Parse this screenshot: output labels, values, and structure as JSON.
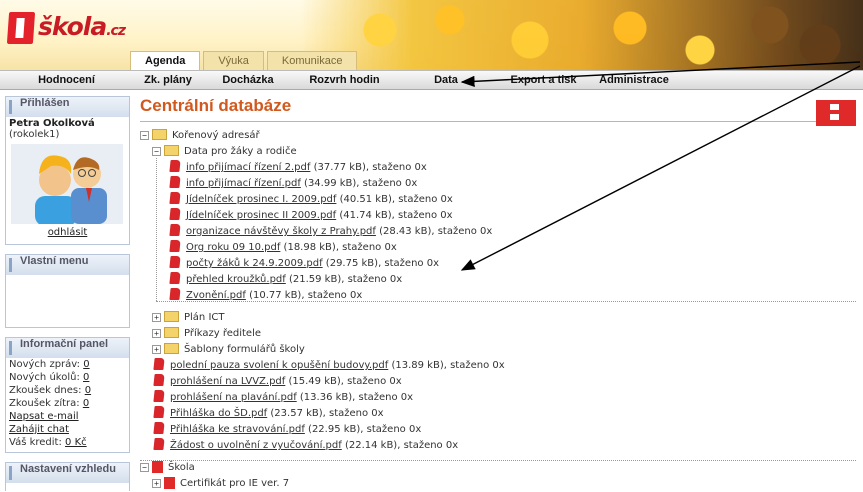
{
  "logo": {
    "text": "škola",
    "suffix": ".cz",
    "prefix": "i"
  },
  "tabs": [
    {
      "label": "Agenda"
    },
    {
      "label": "Výuka"
    },
    {
      "label": "Komunikace"
    }
  ],
  "menu": [
    {
      "label": "Hodnocení"
    },
    {
      "label": "Zk. plány"
    },
    {
      "label": "Docházka"
    },
    {
      "label": "Rozvrh hodin"
    },
    {
      "label": "Data"
    },
    {
      "label": "Export a tisk"
    },
    {
      "label": "Administrace"
    }
  ],
  "sidebar": {
    "login_title": "Přihlášen",
    "user_name": "Petra Okolková",
    "user_login": "(rokolek1)",
    "logout": "odhlásit",
    "own_menu": "Vlastní menu",
    "info_title": "Informační panel",
    "info": {
      "new_messages_label": "Nových zpráv:",
      "new_messages": "0",
      "new_tasks_label": "Nových úkolů:",
      "new_tasks": "0",
      "tests_today_label": "Zkoušek dnes:",
      "tests_today": "0",
      "tests_tomorrow_label": "Zkoušek zítra:",
      "tests_tomorrow": "0",
      "write_email": "Napsat e-mail",
      "start_chat": "Zahájit chat",
      "credit_label": "Váš kredit:",
      "credit": "0 Kč"
    },
    "appearance": "Nastavení vzhledu"
  },
  "main": {
    "title": "Centrální databáze",
    "root": "Kořenový adresář",
    "folder1": "Data pro žáky a rodiče",
    "files1": [
      {
        "name": "info přijímací řízení 2.pdf",
        "meta": " (37.77 kB), staženo 0x"
      },
      {
        "name": "info přijímací řízení.pdf",
        "meta": " (34.99 kB), staženo 0x"
      },
      {
        "name": "Jídelníček prosinec  I. 2009.pdf",
        "meta": " (40.51 kB), staženo 0x"
      },
      {
        "name": "Jídelníček prosinec II 2009.pdf",
        "meta": " (41.74 kB), staženo 0x"
      },
      {
        "name": "organizace návštěvy školy z Prahy.pdf",
        "meta": " (28.43 kB), staženo 0x"
      },
      {
        "name": "Org  roku  09  10.pdf",
        "meta": " (18.98 kB), staženo 0x"
      },
      {
        "name": "počty žáků k 24.9.2009.pdf",
        "meta": " (29.75 kB), staženo 0x"
      },
      {
        "name": "přehled kroužků.pdf",
        "meta": " (21.59 kB), staženo 0x"
      },
      {
        "name": "Zvonění.pdf",
        "meta": " (10.77 kB), staženo 0x"
      }
    ],
    "folders": [
      {
        "label": "Plán ICT"
      },
      {
        "label": "Příkazy ředitele"
      },
      {
        "label": "Šablony formulářů školy"
      }
    ],
    "files2": [
      {
        "name": "polední pauza svolení k opušění budovy.pdf",
        "meta": " (13.89 kB), staženo 0x"
      },
      {
        "name": "prohlášení na LVVZ.pdf",
        "meta": " (15.49 kB), staženo 0x"
      },
      {
        "name": "prohlášení na plavání.pdf",
        "meta": " (13.36 kB), staženo 0x"
      },
      {
        "name": "Přihláška do ŠD.pdf",
        "meta": " (23.57 kB), staženo 0x"
      },
      {
        "name": "Přihláška ke stravování.pdf",
        "meta": " (22.95 kB), staženo 0x"
      },
      {
        "name": "Žádost o uvolnění z vyučování.pdf",
        "meta": " (22.14 kB), staženo 0x"
      }
    ],
    "school_root": "Škola",
    "cert": "Certifikát pro IE ver. 7"
  },
  "colors": {
    "accent": "#d2591e",
    "pdf": "#d8262a",
    "sidebar_border": "#b7c6d9"
  }
}
